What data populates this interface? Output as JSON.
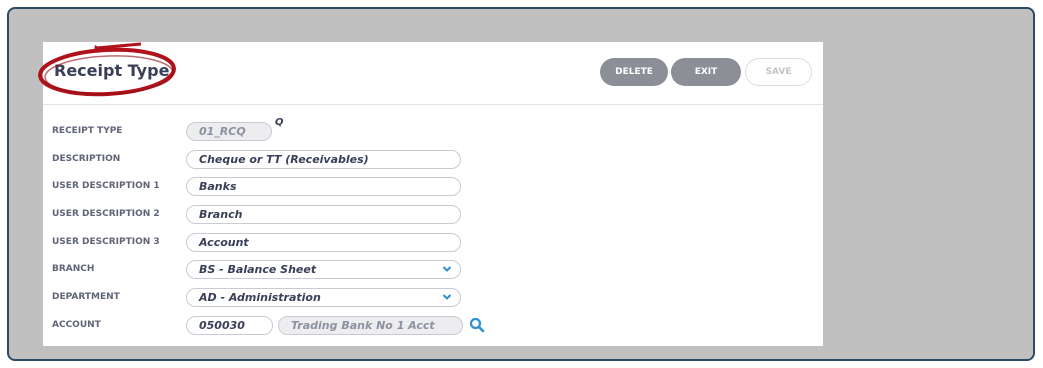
{
  "form": {
    "title": "Receipt Type",
    "buttons": {
      "delete": "DELETE",
      "exit": "EXIT",
      "save": "SAVE"
    },
    "fields": {
      "receipt_type": {
        "label": "RECEIPT TYPE",
        "value": "01_RCQ",
        "suffix": "Q"
      },
      "description": {
        "label": "DESCRIPTION",
        "value": "Cheque or TT (Receivables)"
      },
      "user_description_1": {
        "label": "USER DESCRIPTION 1",
        "value": "Banks"
      },
      "user_description_2": {
        "label": "USER DESCRIPTION 2",
        "value": "Branch"
      },
      "user_description_3": {
        "label": "USER DESCRIPTION 3",
        "value": "Account"
      },
      "branch": {
        "label": "BRANCH",
        "value": "BS - Balance Sheet"
      },
      "department": {
        "label": "DEPARTMENT",
        "value": "AD - Administration"
      },
      "account": {
        "label": "ACCOUNT",
        "code": "050030",
        "name": "Trading Bank No 1 Acct"
      }
    }
  },
  "colors": {
    "annotation_circle": "#b0121b",
    "accent_icon": "#2f8fd0",
    "button_dark": "#8c8f95"
  },
  "icons": {
    "dropdown": "chevron-down-icon",
    "lookup": "search-icon"
  }
}
